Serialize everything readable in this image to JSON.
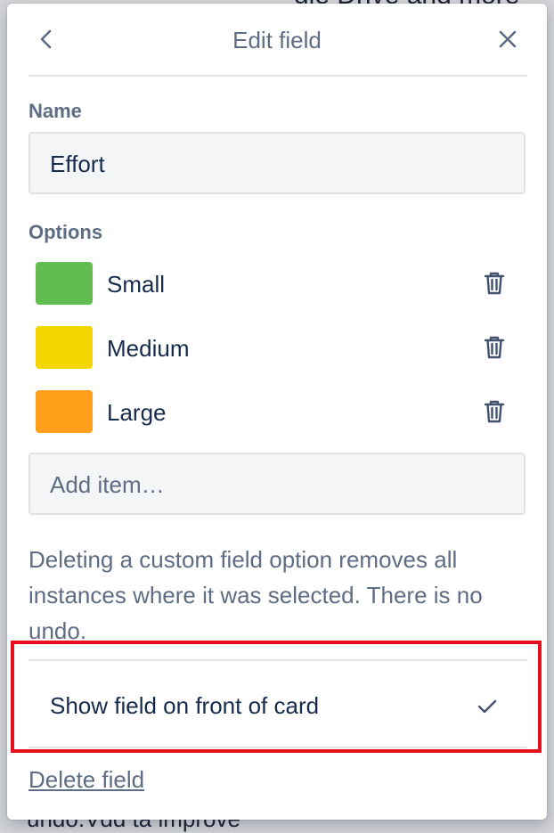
{
  "background": {
    "top_text": "gle Drive and more",
    "bottom_text": "undo.Vdd ta improve"
  },
  "header": {
    "title": "Edit field",
    "back_icon": "chevron-left-icon",
    "close_icon": "close-icon"
  },
  "name_section": {
    "label": "Name",
    "value": "Effort"
  },
  "options_section": {
    "label": "Options",
    "items": [
      {
        "label": "Small",
        "color": "#61bd4f"
      },
      {
        "label": "Medium",
        "color": "#f2d600"
      },
      {
        "label": "Large",
        "color": "#ff9f1a"
      }
    ],
    "delete_icon": "trash-icon",
    "add_placeholder": "Add item…"
  },
  "note": "Deleting a custom field option removes all instances where it was selected. There is no undo.",
  "show_on_card": {
    "label": "Show field on front of card",
    "checked": true,
    "check_icon": "checkmark-icon"
  },
  "delete_field_label": "Delete field",
  "highlight_color": "#e8101c"
}
